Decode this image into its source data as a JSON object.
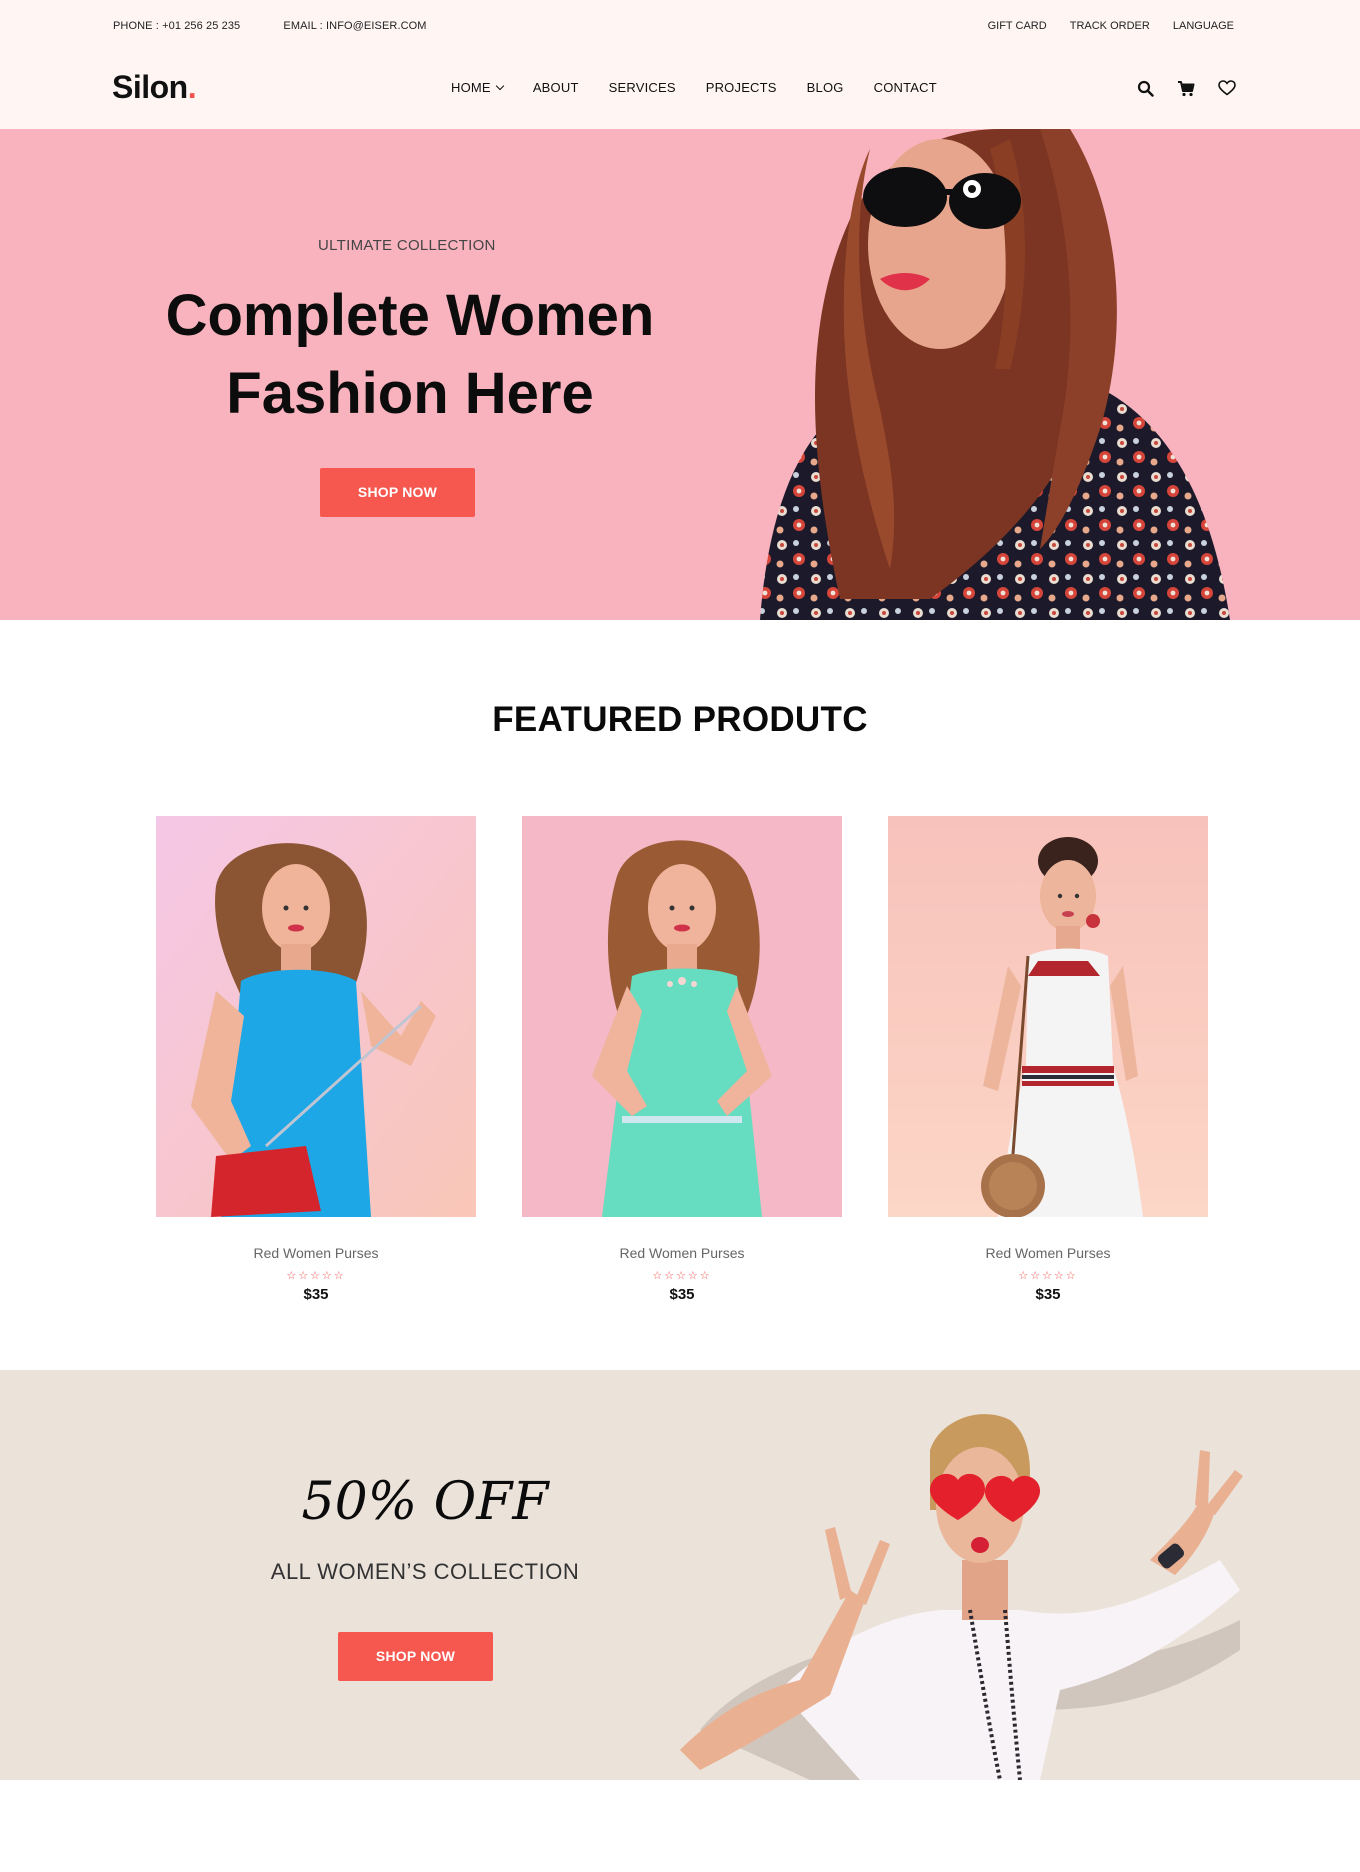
{
  "topbar": {
    "phone": "PHONE : +01 256 25 235",
    "email": "EMAIL : INFO@EISER.COM",
    "links": [
      "GIFT CARD",
      "TRACK ORDER",
      "LANGUAGE"
    ]
  },
  "nav": {
    "logo": "Silon",
    "logo_dot": ".",
    "menu": [
      "HOME",
      "ABOUT",
      "SERVICES",
      "PROJECTS",
      "BLOG",
      "CONTACT"
    ],
    "icons": [
      "search-icon",
      "cart-icon",
      "heart-icon"
    ]
  },
  "hero": {
    "kicker": "ULTIMATE COLLECTION",
    "title_line1": "Complete Women",
    "title_line2": "Fashion Here",
    "button": "SHOP NOW"
  },
  "featured": {
    "title": "FEATURED PRODUTC",
    "products": [
      {
        "name": "Red Women Purses",
        "stars": "☆☆☆☆☆",
        "price": "$35"
      },
      {
        "name": "Red Women Purses",
        "stars": "☆☆☆☆☆",
        "price": "$35"
      },
      {
        "name": "Red Women Purses",
        "stars": "☆☆☆☆☆",
        "price": "$35"
      }
    ]
  },
  "promo": {
    "headline": "50% OFF",
    "subtitle": "ALL WOMEN’S COLLECTION",
    "button": "SHOP NOW"
  },
  "colors": {
    "accent": "#f6574f",
    "hero_bg": "#f8b3be",
    "promo_bg": "#ebe2da",
    "topbar_bg": "#fff6f4"
  }
}
